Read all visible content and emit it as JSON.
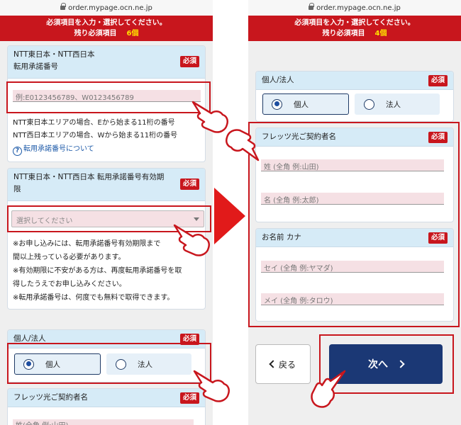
{
  "url": "order.mypage.ocn.ne.jp",
  "banner": {
    "line1": "必須項目を入力・選択してください。",
    "left_remaining_prefix": "残り必須項目",
    "left_remaining_count": "6個",
    "right_remaining_prefix": "残り必須項目",
    "right_remaining_count": "4個"
  },
  "required_badge": "必須",
  "left": {
    "transfer_number": {
      "title_line1": "NTT東日本・NTT西日本",
      "title_line2": "転用承諾番号",
      "placeholder": "例:E0123456789、W0123456789",
      "note1": "NTT東日本エリアの場合、Eから始まる11桁の番号",
      "note2": "NTT西日本エリアの場合、Wから始まる11桁の番号",
      "help_icon": "?",
      "help_link": "転用承諾番号について"
    },
    "expiry": {
      "title_line1": "NTT東日本・NTT西日本 転用承諾番号有効期",
      "title_line2": "限",
      "select_value": "選択してください",
      "notes": [
        "※お申し込みには、転用承諾番号有効期限まで",
        "間以上残っている必要があります。",
        "※有効期限に不安がある方は、再度転用承諾番号を取",
        "得したうえでお申し込みください。",
        "※転用承諾番号は、何度でも無料で取得できます。"
      ]
    },
    "type": {
      "title": "個人/法人",
      "option_personal": "個人",
      "option_corporate": "法人"
    },
    "contractor": {
      "title": "フレッツ光ご契約者名",
      "placeholder_partial": "姓(全角 例:山田)"
    }
  },
  "right": {
    "type": {
      "title": "個人/法人",
      "option_personal": "個人",
      "option_corporate": "法人"
    },
    "contractor": {
      "title": "フレッツ光ご契約者名",
      "last_name_placeholder": "姓 (全角 例:山田)",
      "first_name_placeholder": "名 (全角 例:太郎)"
    },
    "kana": {
      "title": "お名前 カナ",
      "last_kana_placeholder": "セイ (全角 例:ヤマダ)",
      "first_kana_placeholder": "メイ (全角 例:タロウ)"
    },
    "back_button": "戻る",
    "next_button": "次へ"
  },
  "colors": {
    "accent_red": "#c8161d",
    "navy": "#1b3875",
    "header_blue": "#d6ebf7",
    "input_pink": "#f5e0e4"
  }
}
